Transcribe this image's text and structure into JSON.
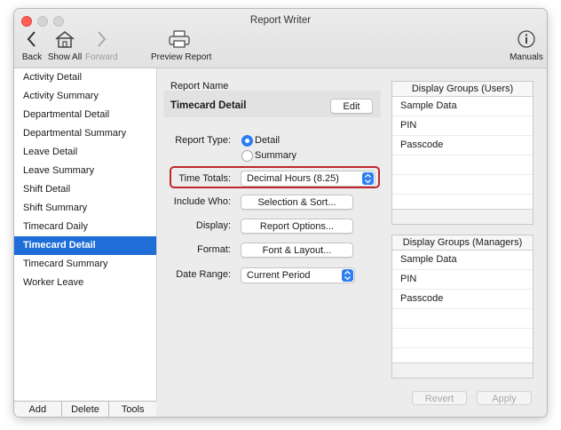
{
  "window": {
    "title": "Report Writer"
  },
  "toolbar": {
    "back": "Back",
    "show_all": "Show All",
    "forward": "Forward",
    "preview": "Preview Report",
    "manuals": "Manuals"
  },
  "sidebar": {
    "items": [
      {
        "label": "Activity Detail"
      },
      {
        "label": "Activity Summary"
      },
      {
        "label": "Departmental Detail"
      },
      {
        "label": "Departmental Summary"
      },
      {
        "label": "Leave Detail"
      },
      {
        "label": "Leave Summary"
      },
      {
        "label": "Shift Detail"
      },
      {
        "label": "Shift Summary"
      },
      {
        "label": "Timecard Daily"
      },
      {
        "label": "Timecard Detail"
      },
      {
        "label": "Timecard Summary"
      },
      {
        "label": "Worker Leave"
      }
    ],
    "selected": "Timecard Detail",
    "add": "Add",
    "delete": "Delete",
    "tools": "Tools"
  },
  "report": {
    "name_label": "Report Name",
    "name": "Timecard Detail",
    "edit": "Edit",
    "type_label": "Report Type:",
    "type_detail": "Detail",
    "type_summary": "Summary",
    "time_totals_label": "Time Totals:",
    "time_totals_value": "Decimal Hours (8.25)",
    "include_label": "Include Who:",
    "include_button": "Selection & Sort...",
    "display_label": "Display:",
    "display_button": "Report Options...",
    "format_label": "Format:",
    "format_button": "Font & Layout...",
    "date_label": "Date Range:",
    "date_value": "Current Period"
  },
  "groups_users": {
    "title": "Display Groups (Users)",
    "rows": [
      "Sample Data",
      "PIN",
      "Passcode"
    ]
  },
  "groups_managers": {
    "title": "Display Groups (Managers)",
    "rows": [
      "Sample Data",
      "PIN",
      "Passcode"
    ]
  },
  "footer": {
    "revert": "Revert",
    "apply": "Apply"
  },
  "colors": {
    "accent": "#1f6ed8",
    "highlight_border": "#c0262c"
  }
}
